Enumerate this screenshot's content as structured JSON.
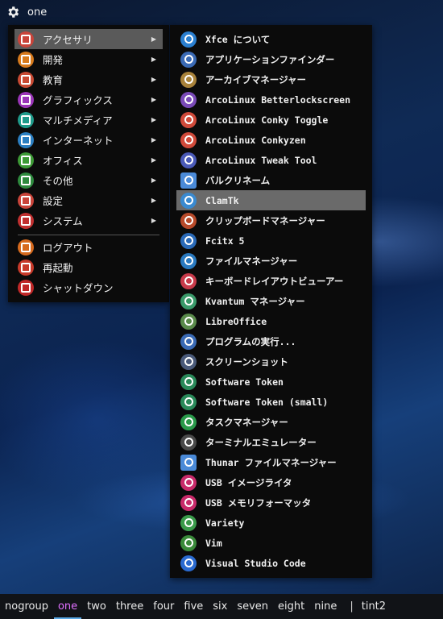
{
  "topbar": {
    "icon": "gear-icon",
    "workspace_name": "one"
  },
  "main_menu": {
    "items": [
      {
        "label": "アクセサリ",
        "icon": "accessories-icon",
        "color": "#c9443a",
        "submenu": true,
        "selected": true
      },
      {
        "label": "開発",
        "icon": "development-icon",
        "color": "#d77a1d",
        "submenu": true
      },
      {
        "label": "教育",
        "icon": "education-icon",
        "color": "#c84a33",
        "submenu": true
      },
      {
        "label": "グラフィックス",
        "icon": "graphics-icon",
        "color": "#9a35b8",
        "submenu": true
      },
      {
        "label": "マルチメディア",
        "icon": "multimedia-icon",
        "color": "#1f9a8a",
        "submenu": true
      },
      {
        "label": "インターネット",
        "icon": "internet-icon",
        "color": "#2b7fc1",
        "submenu": true
      },
      {
        "label": "オフィス",
        "icon": "office-icon",
        "color": "#3d9a36",
        "submenu": true
      },
      {
        "label": "その他",
        "icon": "other-icon",
        "color": "#2e8a3e",
        "submenu": true
      },
      {
        "label": "設定",
        "icon": "settings-icon",
        "color": "#c9443a",
        "submenu": true
      },
      {
        "label": "システム",
        "icon": "system-icon",
        "color": "#c03030",
        "submenu": true
      },
      {
        "label": "ログアウト",
        "icon": "logout-icon",
        "color": "#d66a1e",
        "submenu": false
      },
      {
        "label": "再起動",
        "icon": "restart-icon",
        "color": "#c83a2a",
        "submenu": false
      },
      {
        "label": "シャットダウン",
        "icon": "shutdown-icon",
        "color": "#c02828",
        "submenu": false
      }
    ]
  },
  "sub_menu": {
    "items": [
      {
        "label": "Xfce について",
        "icon": "info-icon",
        "color": "#2a7fd0"
      },
      {
        "label": "アプリケーションファインダー",
        "icon": "binoculars-icon",
        "color": "#3a6ab5"
      },
      {
        "label": "アーカイブマネージャー",
        "icon": "archive-icon",
        "color": "#a8823a"
      },
      {
        "label": "ArcoLinux Betterlockscreen",
        "icon": "lock-icon",
        "color": "#7a4ab8"
      },
      {
        "label": "ArcoLinux Conky Toggle",
        "icon": "conky-icon",
        "color": "#d04a3a"
      },
      {
        "label": "ArcoLinux Conkyzen",
        "icon": "conkyzen-icon",
        "color": "#d04a3a"
      },
      {
        "label": "ArcoLinux Tweak Tool",
        "icon": "tweak-icon",
        "color": "#4a5ab8"
      },
      {
        "label": "バルクリネーム",
        "icon": "folder-icon",
        "color": "#4a8ad8"
      },
      {
        "label": "ClamTk",
        "icon": "target-icon",
        "color": "#3a8ad0",
        "highlight": true
      },
      {
        "label": "クリップボードマネージャー",
        "icon": "clipboard-icon",
        "color": "#b84a2a"
      },
      {
        "label": "Fcitx 5",
        "icon": "keyboard-icon",
        "color": "#2a6ab8"
      },
      {
        "label": "ファイルマネージャー",
        "icon": "file-manager-icon",
        "color": "#2a7ac0"
      },
      {
        "label": "キーボードレイアウトビューアー",
        "icon": "keyboard-layout-icon",
        "color": "#c83a4a"
      },
      {
        "label": "Kvantum マネージャー",
        "icon": "kvantum-icon",
        "color": "#3a9a6a"
      },
      {
        "label": "LibreOffice",
        "icon": "libreoffice-icon",
        "color": "#5a8a4a"
      },
      {
        "label": "プログラムの実行...",
        "icon": "run-icon",
        "color": "#3a6ab5"
      },
      {
        "label": "スクリーンショット",
        "icon": "screenshot-icon",
        "color": "#4a5a7a"
      },
      {
        "label": "Software Token",
        "icon": "token-icon",
        "color": "#2a8a5a"
      },
      {
        "label": "Software Token (small)",
        "icon": "token-small-icon",
        "color": "#2a8a5a"
      },
      {
        "label": "タスクマネージャー",
        "icon": "task-manager-icon",
        "color": "#2a9a4a"
      },
      {
        "label": "ターミナルエミュレーター",
        "icon": "terminal-icon",
        "color": "#4a4a4a"
      },
      {
        "label": "Thunar ファイルマネージャー",
        "icon": "thunar-icon",
        "color": "#4a8ad8"
      },
      {
        "label": "USB イメージライタ",
        "icon": "usb-writer-icon",
        "color": "#c82a6a"
      },
      {
        "label": "USB メモリフォーマッタ",
        "icon": "usb-format-icon",
        "color": "#c82a6a"
      },
      {
        "label": "Variety",
        "icon": "variety-icon",
        "color": "#3a9a4a"
      },
      {
        "label": "Vim",
        "icon": "vim-icon",
        "color": "#3a8a3a"
      },
      {
        "label": "Visual Studio Code",
        "icon": "vscode-icon",
        "color": "#2a6ad0"
      }
    ]
  },
  "taskbar": {
    "workspaces": [
      "nogroup",
      "one",
      "two",
      "three",
      "four",
      "five",
      "six",
      "seven",
      "eight",
      "nine"
    ],
    "active_workspace": "one",
    "separator": "|",
    "app_label": "tint2"
  }
}
